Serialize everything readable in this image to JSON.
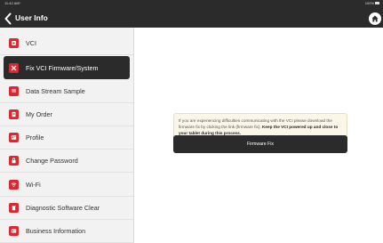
{
  "status_bar": {
    "time": "11:42 AM",
    "wifi_icon": "wifi-icon",
    "battery_text": "100%"
  },
  "header": {
    "title": "User Info",
    "back_icon": "back-arrow-icon",
    "home_icon": "home-icon"
  },
  "sidebar": {
    "items": [
      {
        "label": "VCI",
        "icon": "vci-icon",
        "active": false
      },
      {
        "label": "Fix VCI Firmware/System",
        "icon": "tools-icon",
        "active": true
      },
      {
        "label": "Data Stream Sample",
        "icon": "data-stream-icon",
        "active": false
      },
      {
        "label": "My Order",
        "icon": "order-icon",
        "active": false
      },
      {
        "label": "Profile",
        "icon": "profile-icon",
        "active": false
      },
      {
        "label": "Change Password",
        "icon": "lock-icon",
        "active": false
      },
      {
        "label": "Wi-Fi",
        "icon": "wifi-icon",
        "active": false
      },
      {
        "label": "Diagnostic Software Clear",
        "icon": "clear-icon",
        "active": false
      },
      {
        "label": "Business Information",
        "icon": "business-card-icon",
        "active": false
      }
    ]
  },
  "main": {
    "notice_text": "If you are experiencing difficulties communicating with the VCI please download the firmware fix by clicking the link (firmware fix).",
    "notice_bold": "Keep the VCI powered up and close to your tablet during this process.",
    "button_label": "Firmware Fix"
  },
  "colors": {
    "header_bg": "#2b2b2b",
    "accent_red": "#d9282f",
    "sidebar_bg": "#f2f2f2",
    "notice_bg": "#fbf7e8"
  }
}
